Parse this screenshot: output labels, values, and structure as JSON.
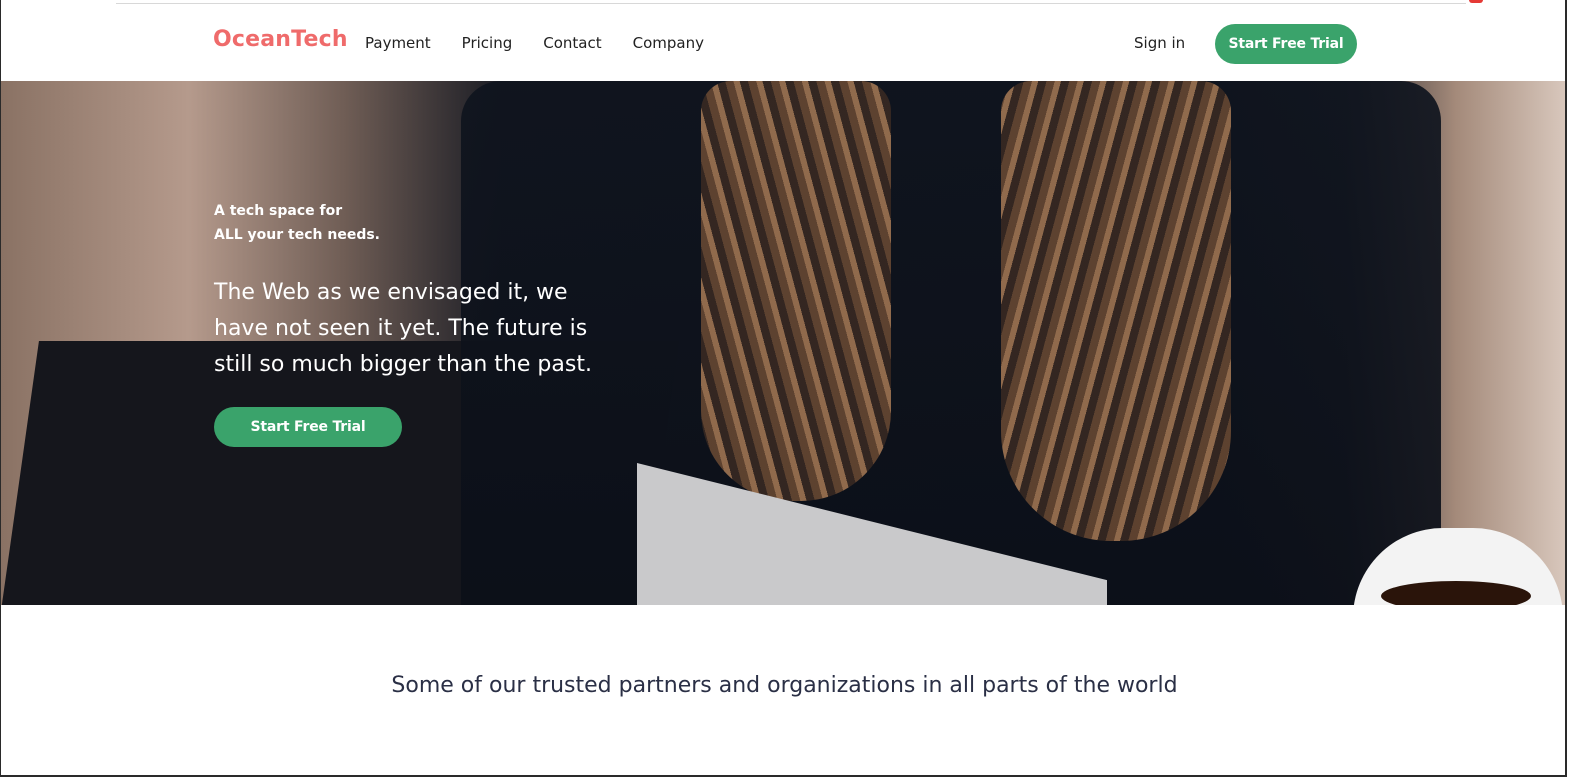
{
  "brand": {
    "name": "OceanTech",
    "color": "#ef6b6b"
  },
  "nav": {
    "links": [
      "Payment",
      "Pricing",
      "Contact",
      "Company"
    ],
    "sign_in": "Sign in",
    "cta": "Start Free Trial"
  },
  "hero": {
    "tagline_line1": "A tech space for",
    "tagline_line2": "ALL your tech needs.",
    "headline": "The Web as we envisaged it, we have not seen it yet. The future is still so much bigger than the past.",
    "cta": "Start Free Trial"
  },
  "partners": {
    "heading": "Some of our trusted partners and organizations in all parts of the world"
  },
  "colors": {
    "accent": "#3aa36b",
    "brand": "#ef6b6b",
    "text": "#222222"
  }
}
